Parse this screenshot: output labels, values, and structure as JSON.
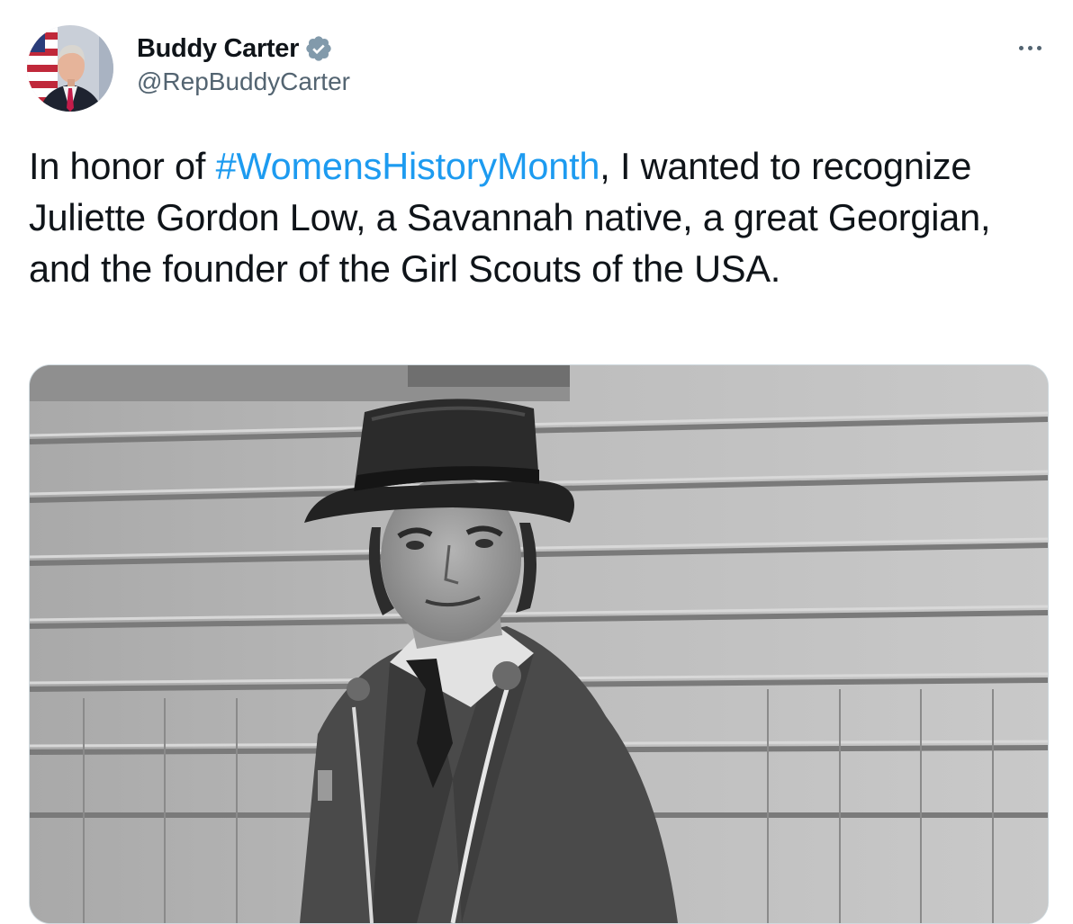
{
  "author": {
    "display_name": "Buddy Carter",
    "handle": "@RepBuddyCarter",
    "verified": true
  },
  "tweet": {
    "text_before": "In honor of ",
    "hashtag": "#WomensHistoryMonth",
    "text_after": ", I wanted to recognize Juliette Gordon Low, a Savannah native, a great Georgian, and the founder of the Girl Scouts of the USA."
  },
  "icons": {
    "verified": "verified-badge-icon",
    "more": "more-options-icon"
  },
  "colors": {
    "link": "#1d9bf0",
    "text": "#0f1419",
    "secondary": "#536471",
    "border": "#cfd9de"
  }
}
